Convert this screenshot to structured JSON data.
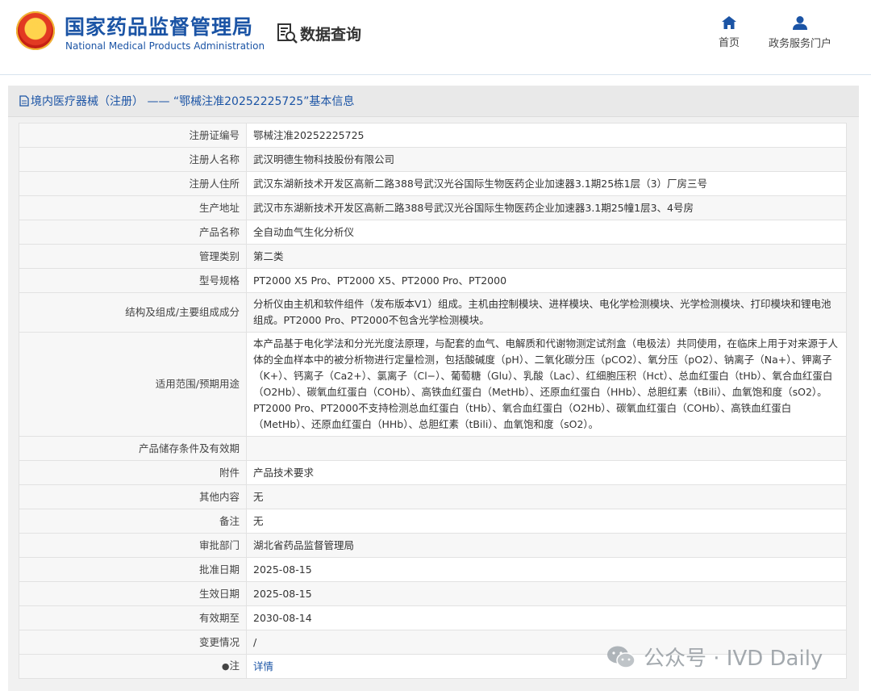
{
  "header": {
    "brand_cn": "国家药品监督管理局",
    "brand_en": "National Medical Products Administration",
    "data_query": "数据查询",
    "nav": {
      "home": "首页",
      "portal": "政务服务门户"
    }
  },
  "panel": {
    "title": "境内医疗器械（注册） —— “鄂械注准20252225725”基本信息"
  },
  "rows": [
    {
      "label": "注册证编号",
      "value": "鄂械注准20252225725"
    },
    {
      "label": "注册人名称",
      "value": "武汉明德生物科技股份有限公司"
    },
    {
      "label": "注册人住所",
      "value": "武汉东湖新技术开发区高新二路388号武汉光谷国际生物医药企业加速器3.1期25栋1层（3）厂房三号"
    },
    {
      "label": "生产地址",
      "value": "武汉市东湖新技术开发区高新二路388号武汉光谷国际生物医药企业加速器3.1期25幢1层3、4号房"
    },
    {
      "label": "产品名称",
      "value": "全自动血气生化分析仪"
    },
    {
      "label": "管理类别",
      "value": "第二类"
    },
    {
      "label": "型号规格",
      "value": "PT2000 X5 Pro、PT2000 X5、PT2000 Pro、PT2000"
    },
    {
      "label": "结构及组成/主要组成成分",
      "value": "分析仪由主机和软件组件（发布版本V1）组成。主机由控制模块、进样模块、电化学检测模块、光学检测模块、打印模块和锂电池组成。PT2000 Pro、PT2000不包含光学检测模块。"
    },
    {
      "label": "适用范围/预期用途",
      "value": "本产品基于电化学法和分光光度法原理，与配套的血气、电解质和代谢物测定试剂盒（电极法）共同使用，在临床上用于对来源于人体的全血样本中的被分析物进行定量检测，包括酸碱度（pH）、二氧化碳分压（pCO2）、氧分压（pO2）、钠离子（Na+）、钾离子（K+）、钙离子（Ca2+）、氯离子（Cl−）、葡萄糖（Glu）、乳酸（Lac）、红细胞压积（Hct）、总血红蛋白（tHb）、氧合血红蛋白（O2Hb）、碳氧血红蛋白（COHb）、高铁血红蛋白（MetHb）、还原血红蛋白（HHb）、总胆红素（tBili）、血氧饱和度（sO2）。PT2000 Pro、PT2000不支持检测总血红蛋白（tHb）、氧合血红蛋白（O2Hb）、碳氧血红蛋白（COHb）、高铁血红蛋白（MetHb）、还原血红蛋白（HHb）、总胆红素（tBili）、血氧饱和度（sO2）。"
    },
    {
      "label": "产品储存条件及有效期",
      "value": ""
    },
    {
      "label": "附件",
      "value": "产品技术要求"
    },
    {
      "label": "其他内容",
      "value": "无"
    },
    {
      "label": "备注",
      "value": "无"
    },
    {
      "label": "审批部门",
      "value": "湖北省药品监督管理局"
    },
    {
      "label": "批准日期",
      "value": "2025-08-15"
    },
    {
      "label": "生效日期",
      "value": "2025-08-15"
    },
    {
      "label": "有效期至",
      "value": "2030-08-14"
    },
    {
      "label": "变更情况",
      "value": "/"
    },
    {
      "label": "注",
      "value": "详情"
    }
  ],
  "watermark": "公众号 · IVD Daily",
  "colors": {
    "brand_blue": "#1b54a5",
    "panel_bg": "#f1f1f1",
    "emblem_red": "#d42a1c",
    "emblem_gold": "#ffd34d"
  },
  "icons": {
    "emblem": "national-emblem-icon",
    "data_query": "document-search-icon",
    "home": "home-icon",
    "portal": "user-icon",
    "title": "document-icon",
    "note": "map-pin-icon",
    "watermark": "wechat-icon"
  }
}
